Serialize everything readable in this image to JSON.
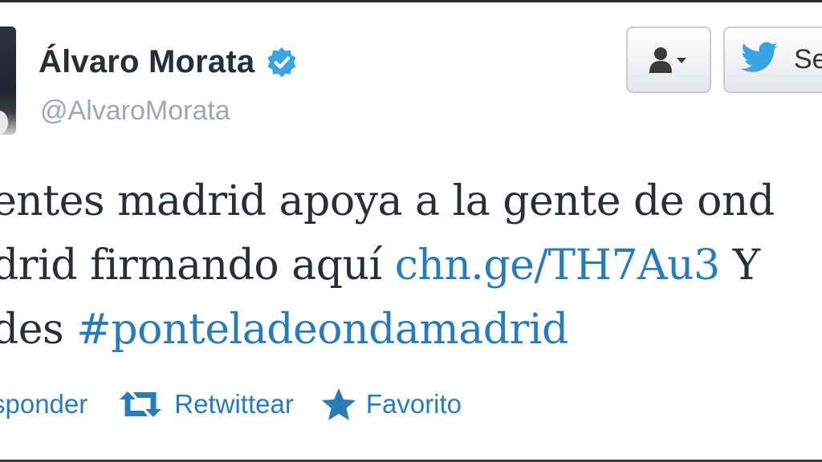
{
  "profile": {
    "display_name": "Álvaro Morata",
    "handle": "@AlvaroMorata",
    "verified": true
  },
  "header_buttons": {
    "follow_icon": "user-dropdown-icon",
    "tweet_label": "Se"
  },
  "tweet": {
    "line1_text": "entes madrid apoya a la gente de ond",
    "line2_text": "drid firmando aquí ",
    "line2_link": "chn.ge/TH7Au3",
    "line2_tail": " Y",
    "line3_text": "des ",
    "line3_hashtag": "#ponteladeondamadrid"
  },
  "actions": {
    "reply_label": "sponder",
    "retweet_label": "Retwittear",
    "favorite_label": "Favorito"
  },
  "colors": {
    "link": "#2b7bb9",
    "text": "#292f33",
    "muted": "#a0a7ad",
    "verified": "#3aa3e3"
  }
}
